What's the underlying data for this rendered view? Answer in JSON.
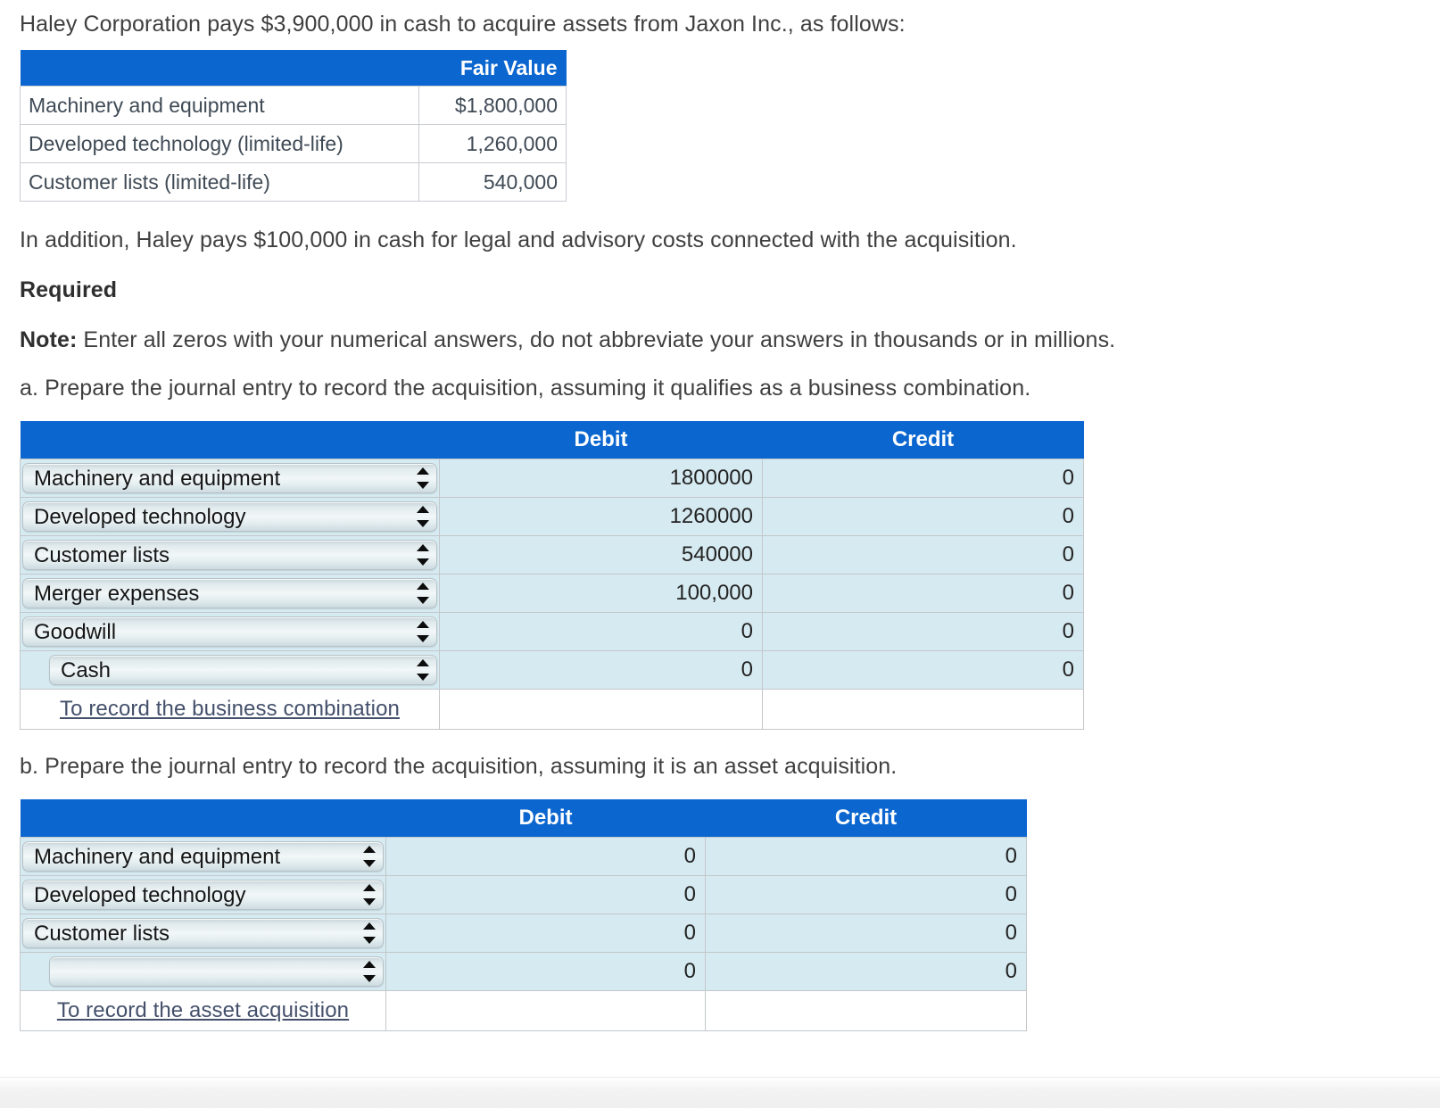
{
  "intro": {
    "text": "Haley Corporation pays $3,900,000 in cash to acquire assets from Jaxon Inc., as follows:"
  },
  "fair_value_table": {
    "blank_header": "",
    "header": "Fair Value",
    "rows": [
      {
        "label": "Machinery and equipment",
        "value": "$1,800,000"
      },
      {
        "label": "Developed technology (limited-life)",
        "value": "1,260,000"
      },
      {
        "label": "Customer lists (limited-life)",
        "value": "540,000"
      }
    ]
  },
  "addition_text": "In addition, Haley pays $100,000 in cash for legal and advisory costs connected with the acquisition.",
  "required_heading": "Required",
  "note": {
    "lead": "Note:",
    "text": " Enter all zeros with your numerical answers, do not abbreviate your answers in thousands or in millions."
  },
  "part_a": {
    "prompt": "a. Prepare the journal entry to record the acquisition, assuming it qualifies as a business combination.",
    "columns": {
      "account": "",
      "debit": "Debit",
      "credit": "Credit"
    },
    "rows": [
      {
        "account": "Machinery and equipment",
        "debit": "1800000",
        "credit": "0",
        "indent": false
      },
      {
        "account": "Developed technology",
        "debit": "1260000",
        "credit": "0",
        "indent": false
      },
      {
        "account": "Customer lists",
        "debit": "540000",
        "credit": "0",
        "indent": false
      },
      {
        "account": "Merger expenses",
        "debit": "100,000",
        "credit": "0",
        "indent": false
      },
      {
        "account": "Goodwill",
        "debit": "0",
        "credit": "0",
        "indent": false
      },
      {
        "account": "Cash",
        "debit": "0",
        "credit": "0",
        "indent": true
      }
    ],
    "memo": "To record the business combination"
  },
  "part_b": {
    "prompt": "b. Prepare the journal entry to record the acquisition, assuming it is an asset acquisition.",
    "columns": {
      "account": "",
      "debit": "Debit",
      "credit": "Credit"
    },
    "rows": [
      {
        "account": "Machinery and equipment",
        "debit": "0",
        "credit": "0",
        "indent": false
      },
      {
        "account": "Developed technology",
        "debit": "0",
        "credit": "0",
        "indent": false
      },
      {
        "account": "Customer lists",
        "debit": "0",
        "credit": "0",
        "indent": false
      },
      {
        "account": "",
        "debit": "0",
        "credit": "0",
        "indent": true
      }
    ],
    "memo": "To record the asset acquisition"
  },
  "colors": {
    "header_blue": "#0b66d0",
    "cell_blue": "#d6eaf1",
    "memo_link": "#44506b"
  }
}
